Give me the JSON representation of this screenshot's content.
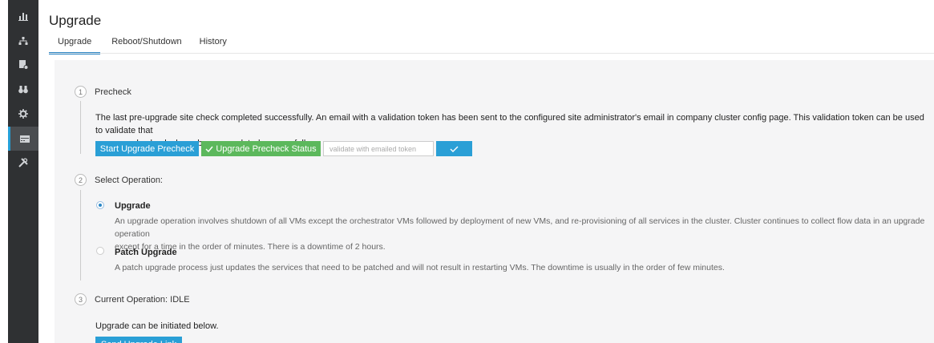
{
  "page": {
    "title": "Upgrade"
  },
  "tabs": [
    {
      "label": "Upgrade",
      "active": true
    },
    {
      "label": "Reboot/Shutdown",
      "active": false
    },
    {
      "label": "History",
      "active": false
    }
  ],
  "sidebar": {
    "items": [
      {
        "icon": "bar-chart-icon"
      },
      {
        "icon": "network-icon"
      },
      {
        "icon": "policy-icon"
      },
      {
        "icon": "binoculars-icon"
      },
      {
        "icon": "gear-icon"
      },
      {
        "icon": "server-icon",
        "active": true
      },
      {
        "icon": "tools-icon"
      }
    ]
  },
  "steps": {
    "precheck": {
      "number": "1",
      "title": "Precheck",
      "message_line1": "The last pre-upgrade site check completed successfully. An email with a validation token has been sent to the configured site administrator's email in company cluster config page. This validation token can be used to validate that",
      "message_line2": "pre-upgrade checks have been completed successfully.",
      "start_button": "Start Upgrade Precheck",
      "status_button": "Upgrade Precheck Status",
      "token_placeholder": "validate with emailed token"
    },
    "select_operation": {
      "number": "2",
      "title": "Select Operation:",
      "options": [
        {
          "title": "Upgrade",
          "selected": true,
          "desc_line1": "An upgrade operation involves shutdown of all VMs except the orchestrator VMs followed by deployment of new VMs, and re-provisioning of all services in the cluster. Cluster continues to collect flow data in an upgrade operation",
          "desc_line2": "except for a time in the order of minutes. There is a downtime of 2 hours."
        },
        {
          "title": "Patch Upgrade",
          "selected": false,
          "desc_line1": "A patch upgrade process just updates the services that need to be patched and will not result in restarting VMs. The downtime is usually in the order of few minutes."
        }
      ]
    },
    "current_operation": {
      "number": "3",
      "title": "Current Operation: IDLE",
      "message": "Upgrade can be initiated below.",
      "button": "Send Upgrade Link"
    }
  },
  "colors": {
    "primary": "#2a9fd6",
    "success": "#5cb85c",
    "sidebar": "#2f3133"
  }
}
